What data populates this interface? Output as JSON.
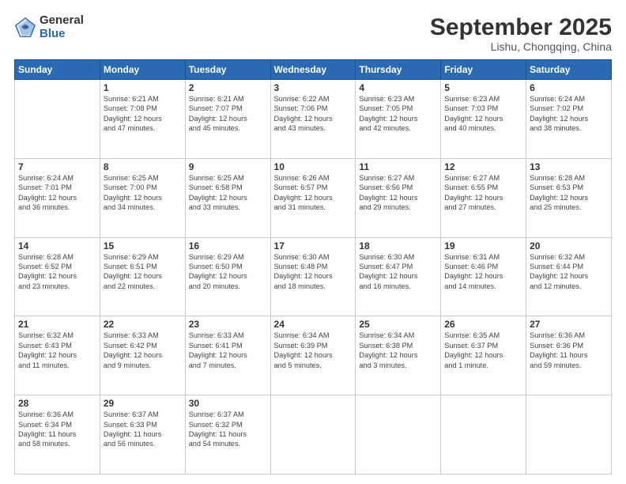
{
  "logo": {
    "general": "General",
    "blue": "Blue"
  },
  "header": {
    "title": "September 2025",
    "subtitle": "Lishu, Chongqing, China"
  },
  "weekdays": [
    "Sunday",
    "Monday",
    "Tuesday",
    "Wednesday",
    "Thursday",
    "Friday",
    "Saturday"
  ],
  "weeks": [
    [
      {
        "num": "",
        "info": ""
      },
      {
        "num": "1",
        "info": "Sunrise: 6:21 AM\nSunset: 7:08 PM\nDaylight: 12 hours\nand 47 minutes."
      },
      {
        "num": "2",
        "info": "Sunrise: 6:21 AM\nSunset: 7:07 PM\nDaylight: 12 hours\nand 45 minutes."
      },
      {
        "num": "3",
        "info": "Sunrise: 6:22 AM\nSunset: 7:06 PM\nDaylight: 12 hours\nand 43 minutes."
      },
      {
        "num": "4",
        "info": "Sunrise: 6:23 AM\nSunset: 7:05 PM\nDaylight: 12 hours\nand 42 minutes."
      },
      {
        "num": "5",
        "info": "Sunrise: 6:23 AM\nSunset: 7:03 PM\nDaylight: 12 hours\nand 40 minutes."
      },
      {
        "num": "6",
        "info": "Sunrise: 6:24 AM\nSunset: 7:02 PM\nDaylight: 12 hours\nand 38 minutes."
      }
    ],
    [
      {
        "num": "7",
        "info": "Sunrise: 6:24 AM\nSunset: 7:01 PM\nDaylight: 12 hours\nand 36 minutes."
      },
      {
        "num": "8",
        "info": "Sunrise: 6:25 AM\nSunset: 7:00 PM\nDaylight: 12 hours\nand 34 minutes."
      },
      {
        "num": "9",
        "info": "Sunrise: 6:25 AM\nSunset: 6:58 PM\nDaylight: 12 hours\nand 33 minutes."
      },
      {
        "num": "10",
        "info": "Sunrise: 6:26 AM\nSunset: 6:57 PM\nDaylight: 12 hours\nand 31 minutes."
      },
      {
        "num": "11",
        "info": "Sunrise: 6:27 AM\nSunset: 6:56 PM\nDaylight: 12 hours\nand 29 minutes."
      },
      {
        "num": "12",
        "info": "Sunrise: 6:27 AM\nSunset: 6:55 PM\nDaylight: 12 hours\nand 27 minutes."
      },
      {
        "num": "13",
        "info": "Sunrise: 6:28 AM\nSunset: 6:53 PM\nDaylight: 12 hours\nand 25 minutes."
      }
    ],
    [
      {
        "num": "14",
        "info": "Sunrise: 6:28 AM\nSunset: 6:52 PM\nDaylight: 12 hours\nand 23 minutes."
      },
      {
        "num": "15",
        "info": "Sunrise: 6:29 AM\nSunset: 6:51 PM\nDaylight: 12 hours\nand 22 minutes."
      },
      {
        "num": "16",
        "info": "Sunrise: 6:29 AM\nSunset: 6:50 PM\nDaylight: 12 hours\nand 20 minutes."
      },
      {
        "num": "17",
        "info": "Sunrise: 6:30 AM\nSunset: 6:48 PM\nDaylight: 12 hours\nand 18 minutes."
      },
      {
        "num": "18",
        "info": "Sunrise: 6:30 AM\nSunset: 6:47 PM\nDaylight: 12 hours\nand 16 minutes."
      },
      {
        "num": "19",
        "info": "Sunrise: 6:31 AM\nSunset: 6:46 PM\nDaylight: 12 hours\nand 14 minutes."
      },
      {
        "num": "20",
        "info": "Sunrise: 6:32 AM\nSunset: 6:44 PM\nDaylight: 12 hours\nand 12 minutes."
      }
    ],
    [
      {
        "num": "21",
        "info": "Sunrise: 6:32 AM\nSunset: 6:43 PM\nDaylight: 12 hours\nand 11 minutes."
      },
      {
        "num": "22",
        "info": "Sunrise: 6:33 AM\nSunset: 6:42 PM\nDaylight: 12 hours\nand 9 minutes."
      },
      {
        "num": "23",
        "info": "Sunrise: 6:33 AM\nSunset: 6:41 PM\nDaylight: 12 hours\nand 7 minutes."
      },
      {
        "num": "24",
        "info": "Sunrise: 6:34 AM\nSunset: 6:39 PM\nDaylight: 12 hours\nand 5 minutes."
      },
      {
        "num": "25",
        "info": "Sunrise: 6:34 AM\nSunset: 6:38 PM\nDaylight: 12 hours\nand 3 minutes."
      },
      {
        "num": "26",
        "info": "Sunrise: 6:35 AM\nSunset: 6:37 PM\nDaylight: 12 hours\nand 1 minute."
      },
      {
        "num": "27",
        "info": "Sunrise: 6:36 AM\nSunset: 6:36 PM\nDaylight: 11 hours\nand 59 minutes."
      }
    ],
    [
      {
        "num": "28",
        "info": "Sunrise: 6:36 AM\nSunset: 6:34 PM\nDaylight: 11 hours\nand 58 minutes."
      },
      {
        "num": "29",
        "info": "Sunrise: 6:37 AM\nSunset: 6:33 PM\nDaylight: 11 hours\nand 56 minutes."
      },
      {
        "num": "30",
        "info": "Sunrise: 6:37 AM\nSunset: 6:32 PM\nDaylight: 11 hours\nand 54 minutes."
      },
      {
        "num": "",
        "info": ""
      },
      {
        "num": "",
        "info": ""
      },
      {
        "num": "",
        "info": ""
      },
      {
        "num": "",
        "info": ""
      }
    ]
  ]
}
